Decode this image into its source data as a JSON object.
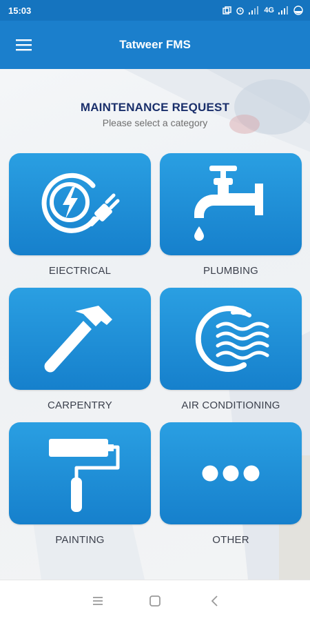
{
  "status_bar": {
    "time": "15:03",
    "network": "4G"
  },
  "app_bar": {
    "title": "Tatweer FMS",
    "menu_icon": "hamburger-menu-icon"
  },
  "header": {
    "title": "MAINTENANCE REQUEST",
    "subtitle": "Please select a category"
  },
  "categories": [
    {
      "label": "EIECTRICAL",
      "icon": "electrical-plug-icon"
    },
    {
      "label": "PLUMBING",
      "icon": "faucet-icon"
    },
    {
      "label": "CARPENTRY",
      "icon": "hammer-icon"
    },
    {
      "label": "AIR CONDITIONING",
      "icon": "air-conditioning-icon"
    },
    {
      "label": "PAINTING",
      "icon": "paint-roller-icon"
    },
    {
      "label": "OTHER",
      "icon": "more-dots-icon"
    }
  ],
  "nav_bar": {
    "icons": [
      "recent-apps-icon",
      "home-icon",
      "back-icon"
    ]
  },
  "colors": {
    "status_bar": "#1574bf",
    "app_bar": "#1b7fcc",
    "tile_top": "#2a9fe2",
    "tile_bottom": "#1680cc",
    "title": "#1a2f6b",
    "label": "#3a3f4b"
  }
}
